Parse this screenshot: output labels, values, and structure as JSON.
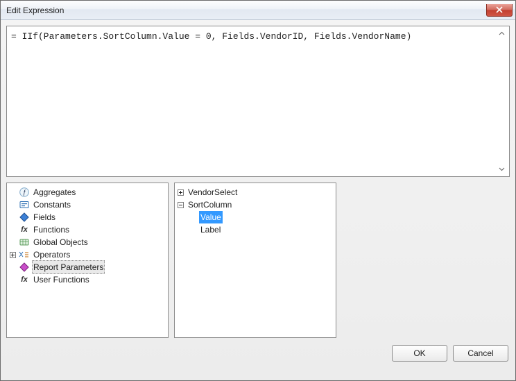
{
  "window": {
    "title": "Edit Expression"
  },
  "expression": {
    "text": "= IIf(Parameters.SortColumn.Value = 0, Fields.VendorID, Fields.VendorName)"
  },
  "categories": {
    "items": [
      {
        "name": "aggregates",
        "label": "Aggregates",
        "icon": "sigma",
        "expandable": false
      },
      {
        "name": "constants",
        "label": "Constants",
        "icon": "const",
        "expandable": false
      },
      {
        "name": "fields",
        "label": "Fields",
        "icon": "field",
        "expandable": false
      },
      {
        "name": "functions",
        "label": "Functions",
        "icon": "fx",
        "expandable": false
      },
      {
        "name": "global-objects",
        "label": "Global Objects",
        "icon": "globe",
        "expandable": false
      },
      {
        "name": "operators",
        "label": "Operators",
        "icon": "ops",
        "expandable": true,
        "expanded": false
      },
      {
        "name": "report-parameters",
        "label": "Report Parameters",
        "icon": "param",
        "expandable": false,
        "selected": true
      },
      {
        "name": "user-functions",
        "label": "User Functions",
        "icon": "fx",
        "expandable": false
      }
    ]
  },
  "members": {
    "items": [
      {
        "name": "vendorselect",
        "label": "VendorSelect",
        "expandable": true,
        "expanded": false
      },
      {
        "name": "sortcolumn",
        "label": "SortColumn",
        "expandable": true,
        "expanded": true,
        "children": [
          {
            "name": "value",
            "label": "Value",
            "highlight": true
          },
          {
            "name": "label",
            "label": "Label"
          }
        ]
      }
    ]
  },
  "buttons": {
    "ok": "OK",
    "cancel": "Cancel"
  }
}
